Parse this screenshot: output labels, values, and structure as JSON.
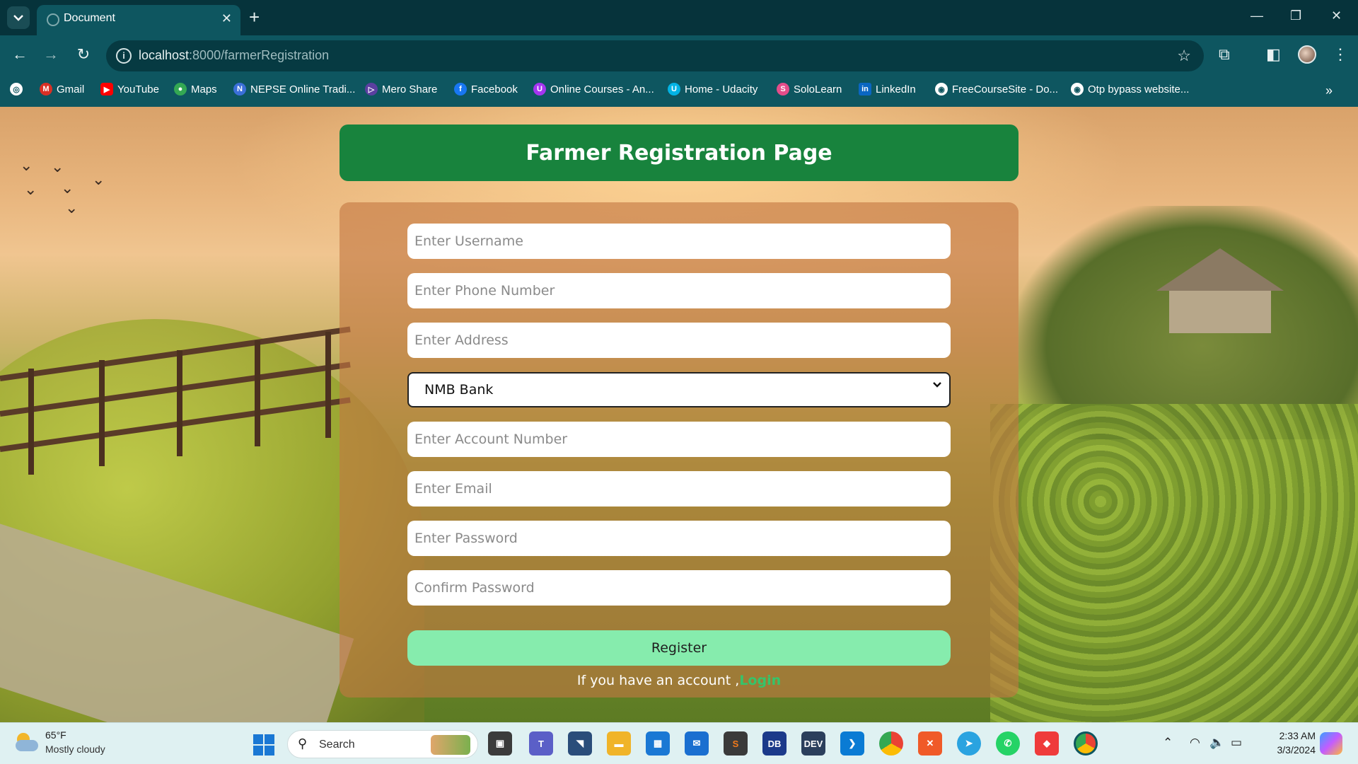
{
  "browser": {
    "tab_title": "Document",
    "new_tab_label": "+",
    "url_host": "localhost",
    "url_path": ":8000/farmerRegistration",
    "bookmarks": [
      {
        "label": "Gmail",
        "icon": "gmail-icon",
        "color": "#d93025"
      },
      {
        "label": "YouTube",
        "icon": "youtube-icon",
        "color": "#ff0000"
      },
      {
        "label": "Maps",
        "icon": "maps-icon",
        "color": "#34a853"
      },
      {
        "label": "NEPSE Online Tradi...",
        "icon": "nepse-icon",
        "color": "#3b6fd8"
      },
      {
        "label": "Mero Share",
        "icon": "mero-share-icon",
        "color": "#5b3fa0"
      },
      {
        "label": "Facebook",
        "icon": "facebook-icon",
        "color": "#1877f2"
      },
      {
        "label": "Online Courses - An...",
        "icon": "udemy-icon",
        "color": "#a435f0"
      },
      {
        "label": "Home - Udacity",
        "icon": "udacity-icon",
        "color": "#02b3e4"
      },
      {
        "label": "SoloLearn",
        "icon": "sololearn-icon",
        "color": "#e44d8a"
      },
      {
        "label": "LinkedIn",
        "icon": "linkedin-icon",
        "color": "#0a66c2"
      },
      {
        "label": "FreeCourseSite - Do...",
        "icon": "globe-icon",
        "color": "#444444"
      },
      {
        "label": "Otp bypass website...",
        "icon": "globe-icon",
        "color": "#444444"
      }
    ]
  },
  "page": {
    "title": "Farmer Registration Page",
    "fields": {
      "username_placeholder": "Enter Username",
      "phone_placeholder": "Enter Phone Number",
      "address_placeholder": "Enter Address",
      "bank_selected": "NMB Bank",
      "account_placeholder": "Enter Account Number",
      "email_placeholder": "Enter Email",
      "password_placeholder": "Enter Password",
      "confirm_placeholder": "Confirm Password"
    },
    "register_label": "Register",
    "login_prompt": "If you have an account ,",
    "login_link": "Login",
    "colors": {
      "header_green": "#18833d",
      "register_button": "#86ecad",
      "login_link": "#35c46a"
    }
  },
  "taskbar": {
    "weather_temp": "65°F",
    "weather_desc": "Mostly cloudy",
    "search_label": "Search",
    "time": "2:33 AM",
    "date": "3/3/2024",
    "apps": [
      {
        "icon": "file-explorer-icon",
        "color": "#f3c32a"
      },
      {
        "icon": "teams-icon",
        "color": "#5b5fc7"
      },
      {
        "icon": "visual-studio-icon",
        "color": "#2a4d7a"
      },
      {
        "icon": "folder-icon",
        "color": "#f0b429"
      },
      {
        "icon": "store-icon",
        "color": "#1a78d4"
      },
      {
        "icon": "mail-icon",
        "color": "#1a6fd0"
      },
      {
        "icon": "sublime-icon",
        "color": "#f27a1a"
      },
      {
        "icon": "db-icon",
        "color": "#1b3a8a"
      },
      {
        "icon": "devcpp-icon",
        "color": "#2b3f5c"
      },
      {
        "icon": "vscode-icon",
        "color": "#0a7bd4"
      },
      {
        "icon": "chrome-icon",
        "color": "#e8a020"
      },
      {
        "icon": "xampp-icon",
        "color": "#f05a28"
      },
      {
        "icon": "telegram-icon",
        "color": "#2aa3e0"
      },
      {
        "icon": "whatsapp-icon",
        "color": "#25d366"
      },
      {
        "icon": "anydesk-icon",
        "color": "#ef3b3b"
      },
      {
        "icon": "chrome-active-icon",
        "color": "#0e5660"
      }
    ]
  }
}
